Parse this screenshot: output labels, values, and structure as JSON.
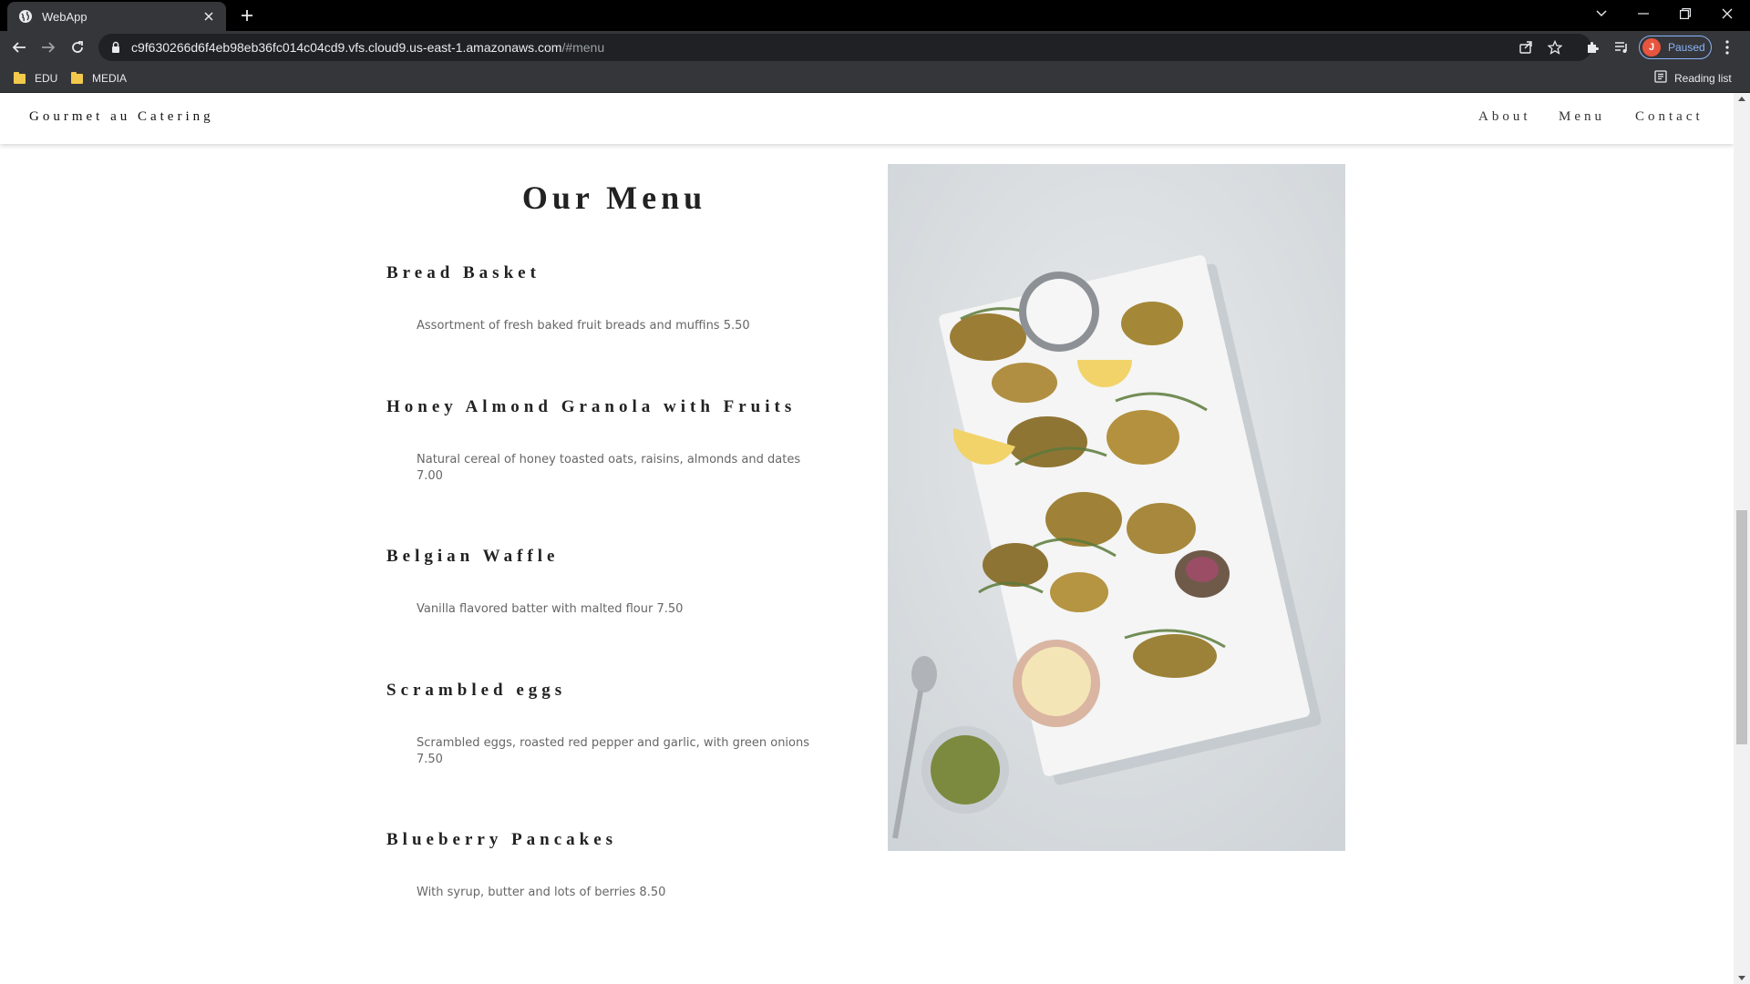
{
  "browser": {
    "tab_title": "WebApp",
    "url_host": "c9f630266d6f4eb98eb36fc014c04cd9.vfs.cloud9.us-east-1.amazonaws.com",
    "url_path": "/#menu",
    "profile_initial": "J",
    "profile_status": "Paused",
    "bookmarks": [
      "EDU",
      "MEDIA"
    ],
    "reading_list_label": "Reading list"
  },
  "site": {
    "brand": "Gourmet au Catering",
    "nav": [
      "About",
      "Menu",
      "Contact"
    ]
  },
  "menu": {
    "title": "Our Menu",
    "items": [
      {
        "name": "Bread Basket",
        "description": "Assortment of fresh baked fruit breads and muffins 5.50"
      },
      {
        "name": "Honey Almond Granola with Fruits",
        "description": "Natural cereal of honey toasted oats, raisins, almonds and dates 7.00"
      },
      {
        "name": "Belgian Waffle",
        "description": "Vanilla flavored batter with malted flour 7.50"
      },
      {
        "name": "Scrambled eggs",
        "description": "Scrambled eggs, roasted red pepper and garlic, with green onions 7.50"
      },
      {
        "name": "Blueberry Pancakes",
        "description": "With syrup, butter and lots of berries 8.50"
      }
    ]
  },
  "colors": {
    "chrome_dark": "#35363a",
    "tabbar": "#000000",
    "profile_accent": "#8ab4f8",
    "avatar": "#e8553e",
    "folder": "#f2c94c"
  }
}
